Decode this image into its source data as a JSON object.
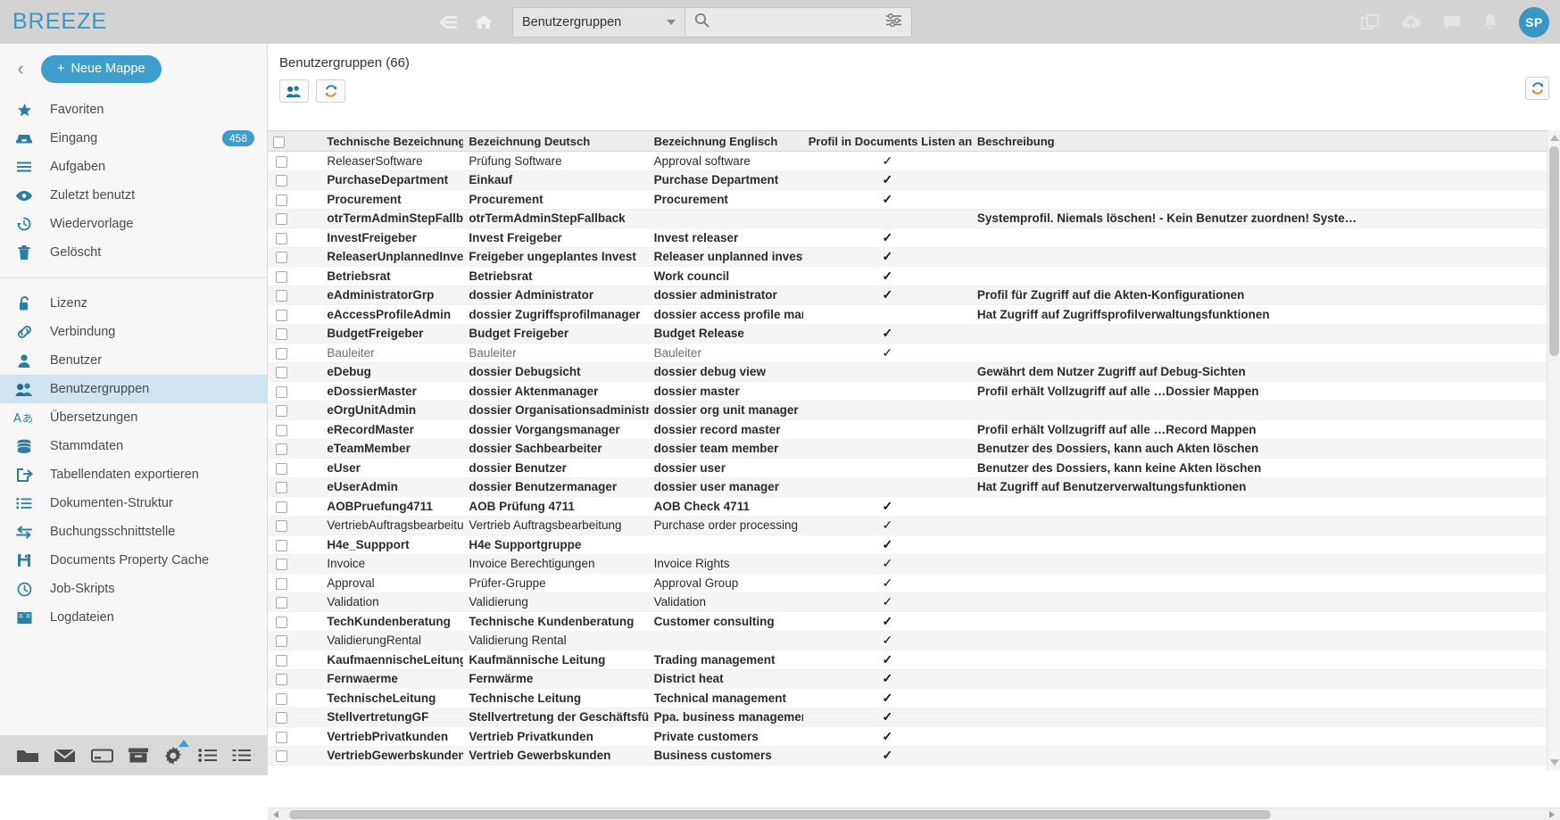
{
  "app": {
    "brand": "BREEZE"
  },
  "topbar": {
    "back_icon": "back-arrow-icon",
    "home_icon": "home-icon",
    "scope_select": "Benutzergruppen",
    "search_placeholder": "",
    "search_value": "",
    "search_icon": "search-icon",
    "filter_icon": "filter-settings-icon",
    "icons": [
      "windows-icon",
      "cloud-upload-icon",
      "chat-icon",
      "bell-icon"
    ],
    "avatar_initials": "SP"
  },
  "sidebar": {
    "new_folder_label": "Neue Mappe",
    "new_folder_plus": "+",
    "collapse_icon": "chevron-left-icon",
    "groups": [
      {
        "items": [
          {
            "label": "Favoriten",
            "icon": "star-icon"
          },
          {
            "label": "Eingang",
            "icon": "inbox-icon",
            "badge": "458"
          },
          {
            "label": "Aufgaben",
            "icon": "tasks-icon"
          },
          {
            "label": "Zuletzt benutzt",
            "icon": "eye-icon"
          },
          {
            "label": "Wiedervorlage",
            "icon": "clock-history-icon"
          },
          {
            "label": "Gelöscht",
            "icon": "trash-icon"
          }
        ]
      },
      {
        "items": [
          {
            "label": "Lizenz",
            "icon": "lock-icon"
          },
          {
            "label": "Verbindung",
            "icon": "link-icon"
          },
          {
            "label": "Benutzer",
            "icon": "user-icon"
          },
          {
            "label": "Benutzergruppen",
            "icon": "users-icon",
            "active": true
          },
          {
            "label": "Übersetzungen",
            "icon": "translate-icon"
          },
          {
            "label": "Stammdaten",
            "icon": "database-icon"
          },
          {
            "label": "Tabellendaten exportieren",
            "icon": "export-icon"
          },
          {
            "label": "Dokumenten-Struktur",
            "icon": "list-structure-icon"
          },
          {
            "label": "Buchungsschnittstelle",
            "icon": "exchange-arrows-icon"
          },
          {
            "label": "Documents Property Cache",
            "icon": "save-disk-icon"
          },
          {
            "label": "Job-Skripts",
            "icon": "clock-icon"
          },
          {
            "label": "Logdateien",
            "icon": "book-icon"
          }
        ]
      }
    ],
    "taskbar_icons": [
      "folder-icon",
      "mail-icon",
      "card-icon",
      "archive-icon",
      "gear-icon",
      "list-icon",
      "list-detail-icon"
    ]
  },
  "main": {
    "title": "Benutzergruppen (66)",
    "tools": [
      {
        "icon": "users-group-icon",
        "name": "new-group-button"
      },
      {
        "icon": "refresh-icon",
        "name": "refresh-button"
      }
    ],
    "refresh_right_icon": "refresh-icon",
    "columns": [
      "Technische Bezeichnung",
      "Bezeichnung Deutsch",
      "Bezeichnung Englisch",
      "Profil in Documents Listen anzeigen",
      "Beschreibung"
    ],
    "check_symbol": "✓",
    "rows": [
      {
        "tech": "ReleaserSoftware",
        "de": "Prüfung Software",
        "en": "Approval software",
        "profil": true,
        "desc": "",
        "bold": false,
        "marked": false
      },
      {
        "tech": "PurchaseDepartment",
        "de": "Einkauf",
        "en": "Purchase Department",
        "profil": true,
        "desc": "",
        "bold": true,
        "marked": true
      },
      {
        "tech": "Procurement",
        "de": "Procurement",
        "en": "Procurement",
        "profil": true,
        "desc": "",
        "bold": true,
        "marked": true
      },
      {
        "tech": "otrTermAdminStepFallback",
        "de": "otrTermAdminStepFallback",
        "en": "",
        "profil": false,
        "desc": "Systemprofil. Niemals löschen! - Kein Benutzer zuordnen! Syste…",
        "bold": true,
        "marked": true
      },
      {
        "tech": "InvestFreigeber",
        "de": "Invest Freigeber",
        "en": "Invest releaser",
        "profil": true,
        "desc": "",
        "bold": true,
        "marked": true
      },
      {
        "tech": "ReleaserUnplannedInvest",
        "de": "Freigeber ungeplantes Invest",
        "en": "Releaser unplanned invest",
        "profil": true,
        "desc": "",
        "bold": true,
        "marked": true
      },
      {
        "tech": "Betriebsrat",
        "de": "Betriebsrat",
        "en": "Work council",
        "profil": true,
        "desc": "",
        "bold": true,
        "marked": true
      },
      {
        "tech": "eAdministratorGrp",
        "de": "dossier Administrator",
        "en": "dossier administrator",
        "profil": true,
        "desc": "Profil für Zugriff auf die Akten-Konfigurationen",
        "bold": true,
        "marked": true
      },
      {
        "tech": "eAccessProfileAdmin",
        "de": "dossier Zugriffsprofilmanager",
        "en": "dossier access profile manager",
        "profil": false,
        "desc": "Hat Zugriff auf Zugriffsprofilverwaltungsfunktionen",
        "bold": true,
        "marked": true
      },
      {
        "tech": "BudgetFreigeber",
        "de": "Budget Freigeber",
        "en": "Budget Release",
        "profil": true,
        "desc": "",
        "bold": true,
        "marked": true
      },
      {
        "tech": "Bauleiter",
        "de": "Bauleiter",
        "en": "Bauleiter",
        "profil": true,
        "desc": "",
        "bold": false,
        "marked": false,
        "dim": true
      },
      {
        "tech": "eDebug",
        "de": "dossier Debugsicht",
        "en": "dossier debug view",
        "profil": false,
        "desc": "Gewährt dem Nutzer Zugriff auf Debug-Sichten",
        "bold": true,
        "marked": true
      },
      {
        "tech": "eDossierMaster",
        "de": "dossier Aktenmanager",
        "en": "dossier master",
        "profil": false,
        "desc": "Profil erhält Vollzugriff auf alle …Dossier Mappen",
        "bold": true,
        "marked": true
      },
      {
        "tech": "eOrgUnitAdmin",
        "de": "dossier Organisationsadministrator",
        "en": "dossier org unit manager",
        "profil": false,
        "desc": "",
        "bold": true,
        "marked": true
      },
      {
        "tech": "eRecordMaster",
        "de": "dossier Vorgangsmanager",
        "en": "dossier record master",
        "profil": false,
        "desc": "Profil erhält Vollzugriff auf alle …Record Mappen",
        "bold": true,
        "marked": true
      },
      {
        "tech": "eTeamMember",
        "de": "dossier Sachbearbeiter",
        "en": "dossier team member",
        "profil": false,
        "desc": "Benutzer des Dossiers, kann auch Akten löschen",
        "bold": true,
        "marked": true
      },
      {
        "tech": "eUser",
        "de": "dossier Benutzer",
        "en": "dossier user",
        "profil": false,
        "desc": "Benutzer des Dossiers, kann keine Akten löschen",
        "bold": true,
        "marked": true
      },
      {
        "tech": "eUserAdmin",
        "de": "dossier Benutzermanager",
        "en": "dossier user manager",
        "profil": false,
        "desc": "Hat Zugriff auf Benutzerverwaltungsfunktionen",
        "bold": true,
        "marked": true
      },
      {
        "tech": "AOBPruefung4711",
        "de": "AOB Prüfung 4711",
        "en": "AOB Check 4711",
        "profil": true,
        "desc": "",
        "bold": true,
        "marked": true
      },
      {
        "tech": "VertriebAuftragsbearbeitung",
        "de": "Vertrieb Auftragsbearbeitung",
        "en": "Purchase order processing",
        "profil": true,
        "desc": "",
        "bold": false,
        "marked": false
      },
      {
        "tech": "H4e_Suppport",
        "de": "H4e Supportgruppe",
        "en": "",
        "profil": true,
        "desc": "",
        "bold": true,
        "marked": true
      },
      {
        "tech": "Invoice",
        "de": "Invoice Berechtigungen",
        "en": "Invoice Rights",
        "profil": true,
        "desc": "",
        "bold": false,
        "marked": false
      },
      {
        "tech": "Approval",
        "de": "Prüfer-Gruppe",
        "en": "Approval Group",
        "profil": true,
        "desc": "",
        "bold": false,
        "marked": false
      },
      {
        "tech": "Validation",
        "de": "Validierung",
        "en": "Validation",
        "profil": true,
        "desc": "",
        "bold": false,
        "marked": false
      },
      {
        "tech": "TechKundenberatung",
        "de": "Technische Kundenberatung",
        "en": "Customer consulting",
        "profil": true,
        "desc": "",
        "bold": true,
        "marked": true
      },
      {
        "tech": "ValidierungRental",
        "de": "Validierung Rental",
        "en": "",
        "profil": true,
        "desc": "",
        "bold": false,
        "marked": false
      },
      {
        "tech": "KaufmaennischeLeitung",
        "de": "Kaufmännische Leitung",
        "en": "Trading management",
        "profil": true,
        "desc": "",
        "bold": true,
        "marked": true
      },
      {
        "tech": "Fernwaerme",
        "de": "Fernwärme",
        "en": "District heat",
        "profil": true,
        "desc": "",
        "bold": true,
        "marked": true
      },
      {
        "tech": "TechnischeLeitung",
        "de": "Technische Leitung",
        "en": "Technical management",
        "profil": true,
        "desc": "",
        "bold": true,
        "marked": true
      },
      {
        "tech": "StellvertretungGF",
        "de": "Stellvertretung der Geschäftsführung",
        "en": "Ppa. business management",
        "profil": true,
        "desc": "",
        "bold": true,
        "marked": true
      },
      {
        "tech": "VertriebPrivatkunden",
        "de": "Vertrieb Privatkunden",
        "en": "Private customers",
        "profil": true,
        "desc": "",
        "bold": true,
        "marked": true
      },
      {
        "tech": "VertriebGewerbskunden",
        "de": "Vertrieb Gewerbskunden",
        "en": "Business customers",
        "profil": true,
        "desc": "",
        "bold": true,
        "marked": true
      }
    ]
  },
  "colors": {
    "accent": "#3f9dcb",
    "brand": "#3a96c4",
    "icon": "#1a7fa8",
    "topbar_bg": "#d3d3d3",
    "active_row": "#cfe4ef"
  }
}
